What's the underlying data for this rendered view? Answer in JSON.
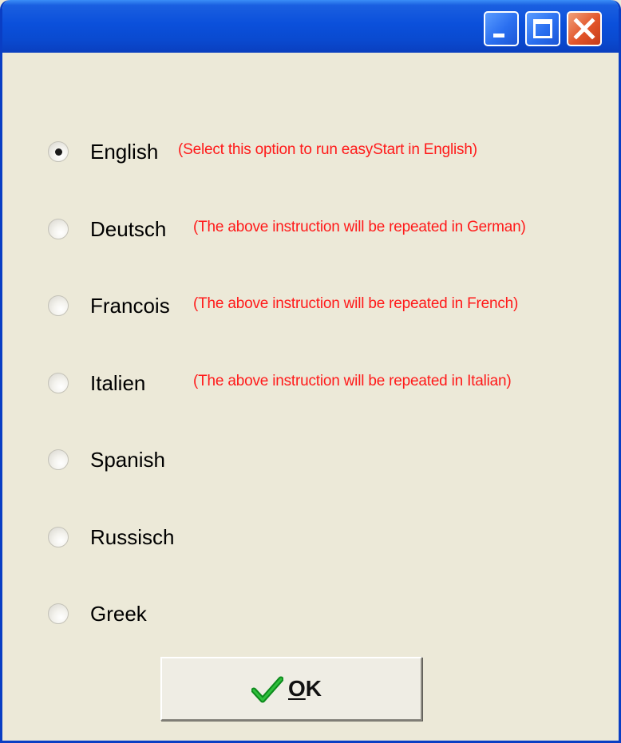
{
  "window": {
    "title": "",
    "controls": {
      "minimize_icon": "minimize-icon",
      "maximize_icon": "maximize-icon",
      "close_icon": "close-icon"
    }
  },
  "colors": {
    "titlebar": "#0a4ad0",
    "background": "#ece9d8",
    "note_text": "#ff1a1a",
    "close_button": "#e2552a"
  },
  "languages": [
    {
      "label": "English",
      "note": "(Select this option to run easyStart  in English)",
      "selected": true
    },
    {
      "label": "Deutsch",
      "note": "(The above instruction will be repeated in German)",
      "selected": false
    },
    {
      "label": "Francois",
      "note": "(The above instruction will be repeated in French)",
      "selected": false
    },
    {
      "label": "Italien",
      "note": "(The above instruction will be repeated in Italian)",
      "selected": false
    },
    {
      "label": "Spanish",
      "note": "",
      "selected": false
    },
    {
      "label": "Russisch",
      "note": "",
      "selected": false
    },
    {
      "label": "Greek",
      "note": "",
      "selected": false
    }
  ],
  "ok_button": {
    "label": "OK",
    "accel_char": "O",
    "rest": "K",
    "icon": "checkmark-icon"
  }
}
